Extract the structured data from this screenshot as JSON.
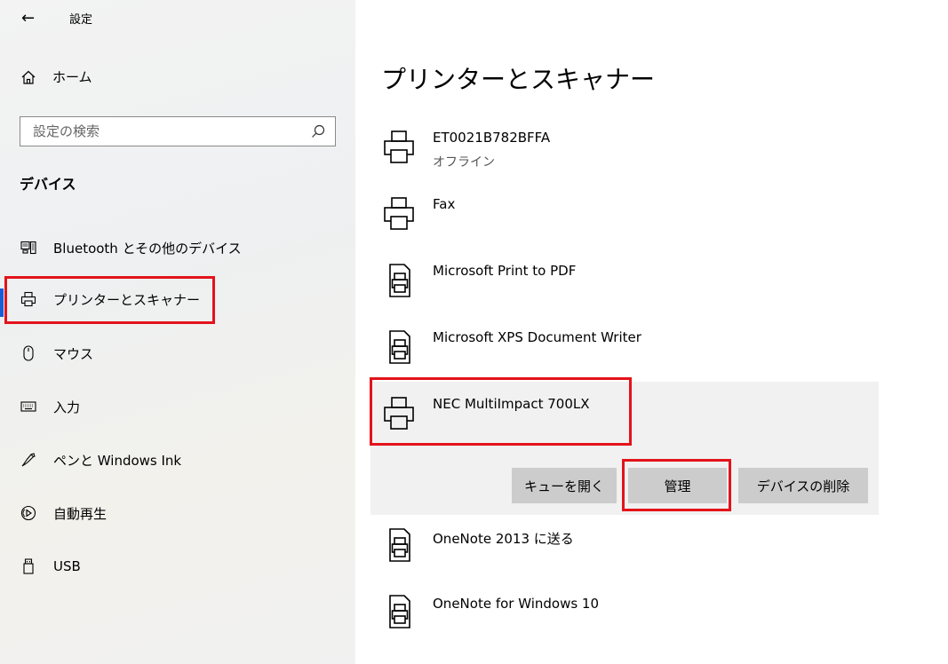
{
  "window": {
    "title": "設定"
  },
  "sidebar": {
    "home_label": "ホーム",
    "search_placeholder": "設定の検索",
    "section_title": "デバイス",
    "items": [
      {
        "label": "Bluetooth とその他のデバイス",
        "icon": "bluetooth-devices-icon"
      },
      {
        "label": "プリンターとスキャナー",
        "icon": "printer-icon",
        "active": true
      },
      {
        "label": "マウス",
        "icon": "mouse-icon"
      },
      {
        "label": "入力",
        "icon": "keyboard-icon"
      },
      {
        "label": "ペンと Windows Ink",
        "icon": "pen-icon"
      },
      {
        "label": "自動再生",
        "icon": "autoplay-icon"
      },
      {
        "label": "USB",
        "icon": "usb-icon"
      }
    ]
  },
  "main": {
    "title": "プリンターとスキャナー",
    "devices": [
      {
        "name": "ET0021B782BFFA",
        "status": "オフライン",
        "icon": "printer-icon"
      },
      {
        "name": "Fax",
        "icon": "printer-icon"
      },
      {
        "name": "Microsoft Print to PDF",
        "icon": "document-printer-icon"
      },
      {
        "name": "Microsoft XPS Document Writer",
        "icon": "document-printer-icon"
      },
      {
        "name": "NEC MultiImpact 700LX",
        "icon": "printer-icon",
        "selected": true
      },
      {
        "name": "OneNote 2013 に送る",
        "icon": "document-printer-icon"
      },
      {
        "name": "OneNote for Windows 10",
        "icon": "document-printer-icon"
      }
    ],
    "actions": {
      "open_queue": "キューを開く",
      "manage": "管理",
      "remove_device": "デバイスの削除"
    }
  },
  "colors": {
    "accent": "#1a5dd6",
    "highlight": "#e3131a",
    "button_bg": "#cccccc",
    "selected_bg": "#f1f1f1"
  }
}
